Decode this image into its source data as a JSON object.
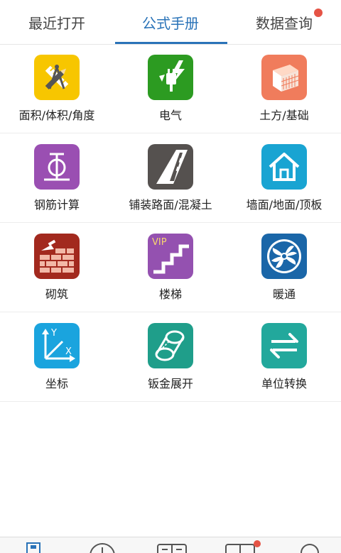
{
  "tabs": [
    {
      "label": "最近打开"
    },
    {
      "label": "公式手册"
    },
    {
      "label": "数据查询"
    }
  ],
  "items": [
    {
      "label": "面积/体积/角度",
      "icon": "ruler-pencil-compass-icon",
      "color": "#f7c600"
    },
    {
      "label": "电气",
      "icon": "plug-lightning-icon",
      "color": "#2c9b21"
    },
    {
      "label": "土方/基础",
      "icon": "foundation-block-icon",
      "color": "#f07c5c"
    },
    {
      "label": "钢筋计算",
      "icon": "rebar-symbol-icon",
      "color": "#9a4fb2"
    },
    {
      "label": "铺装路面/混凝土",
      "icon": "road-icon",
      "color": "#55514f"
    },
    {
      "label": "墙面/地面/顶板",
      "icon": "house-icon",
      "color": "#19a4d2"
    },
    {
      "label": "砌筑",
      "icon": "brick-wall-trowel-icon",
      "color": "#a2291e"
    },
    {
      "label": "楼梯",
      "icon": "stairs-icon",
      "color": "#9451b0",
      "badge": "VIP"
    },
    {
      "label": "暖通",
      "icon": "fan-icon",
      "color": "#1a66a8"
    },
    {
      "label": "坐标",
      "icon": "xy-axis-icon",
      "color": "#1aa4de"
    },
    {
      "label": "钣金展开",
      "icon": "sheet-metal-cylinder-icon",
      "color": "#1f9e8a"
    },
    {
      "label": "单位转换",
      "icon": "swap-arrows-icon",
      "color": "#22a89c"
    }
  ],
  "axis": {
    "y": "Y",
    "x": "X"
  }
}
